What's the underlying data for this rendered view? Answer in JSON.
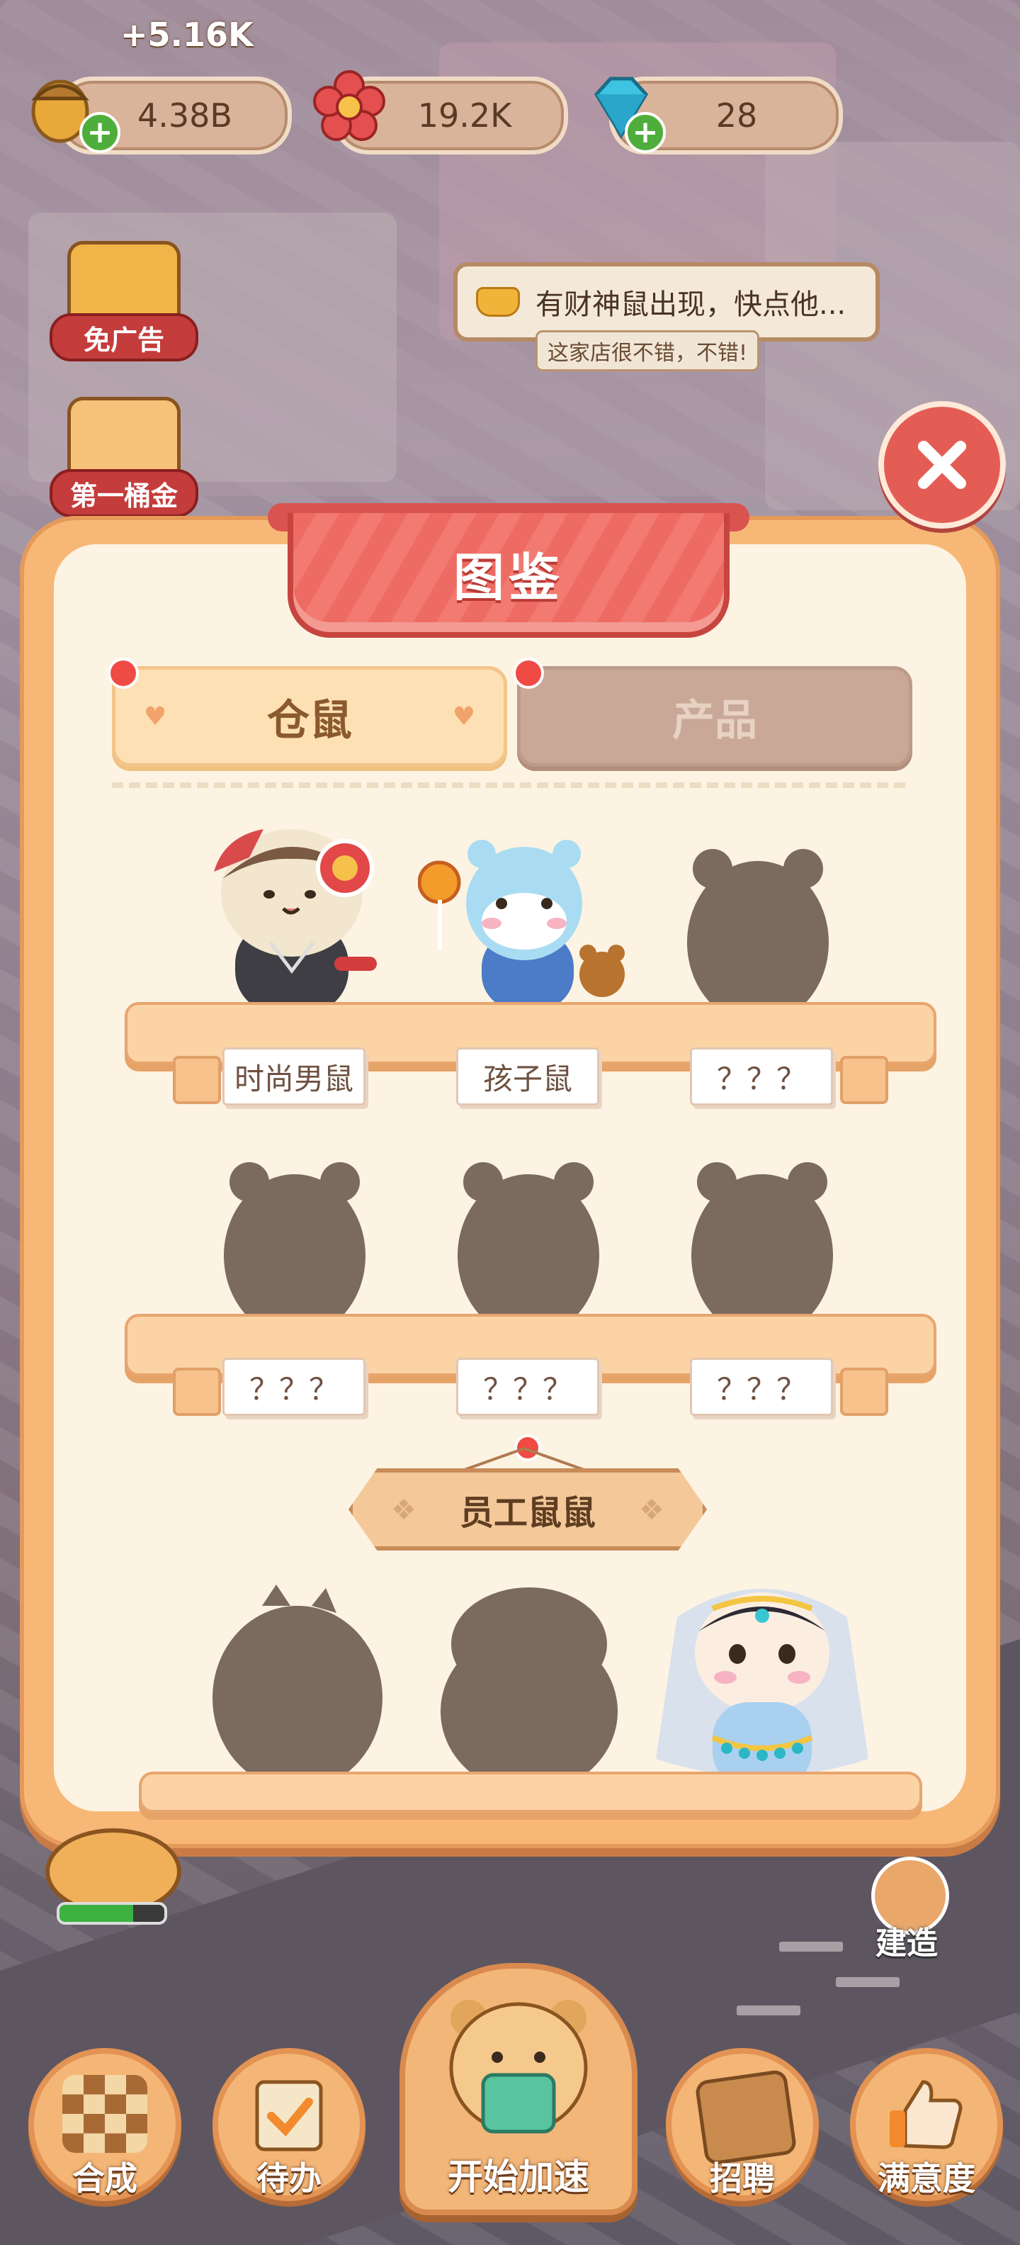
{
  "top_bar": {
    "income_rate": "+5.16K",
    "currencies": [
      {
        "name": "acorn",
        "value": "4.38B",
        "icon": "acorn-icon",
        "has_plus": true
      },
      {
        "name": "flower",
        "value": "19.2K",
        "icon": "flower-icon",
        "has_plus": false
      },
      {
        "name": "diamond",
        "value": "28",
        "icon": "diamond-icon",
        "has_plus": true
      }
    ]
  },
  "side_buttons": {
    "ad_free": "免广告",
    "first_gold": "第一桶金"
  },
  "notice": {
    "text": "有财神鼠出现，快点他...",
    "sub_text": "这家店很不错，不错!"
  },
  "modal": {
    "title": "图鉴",
    "tabs": [
      {
        "label": "仓鼠",
        "active": true
      },
      {
        "label": "产品",
        "active": false
      }
    ],
    "shelf_rows": [
      {
        "items": [
          {
            "name": "时尚男鼠",
            "unlocked": true
          },
          {
            "name": "孩子鼠",
            "unlocked": true
          },
          {
            "name": "？？？",
            "unlocked": false
          }
        ]
      },
      {
        "items": [
          {
            "name": "？？？",
            "unlocked": false
          },
          {
            "name": "？？？",
            "unlocked": false
          },
          {
            "name": "？？？",
            "unlocked": false
          }
        ]
      }
    ],
    "employee_section": {
      "title": "员工鼠鼠",
      "items": [
        {
          "unlocked": false
        },
        {
          "unlocked": false
        },
        {
          "unlocked": true
        }
      ]
    }
  },
  "bottom_nav": {
    "items": [
      {
        "label": "合成",
        "icon": "merge-icon"
      },
      {
        "label": "待办",
        "icon": "todo-icon"
      },
      {
        "label": "开始加速",
        "icon": "speed-up-icon"
      },
      {
        "label": "招聘",
        "icon": "recruit-icon"
      },
      {
        "label": "满意度",
        "icon": "thumbs-up-icon"
      }
    ],
    "build_label": "建造",
    "progress": 0.7
  },
  "colors": {
    "modal_frame": "#f7b877",
    "modal_bg": "#fcf3e3",
    "title_red": "#ee6b63",
    "tab_active": "#fde0b3",
    "tab_inactive": "#c9a898",
    "silhouette": "#7b6a60"
  }
}
